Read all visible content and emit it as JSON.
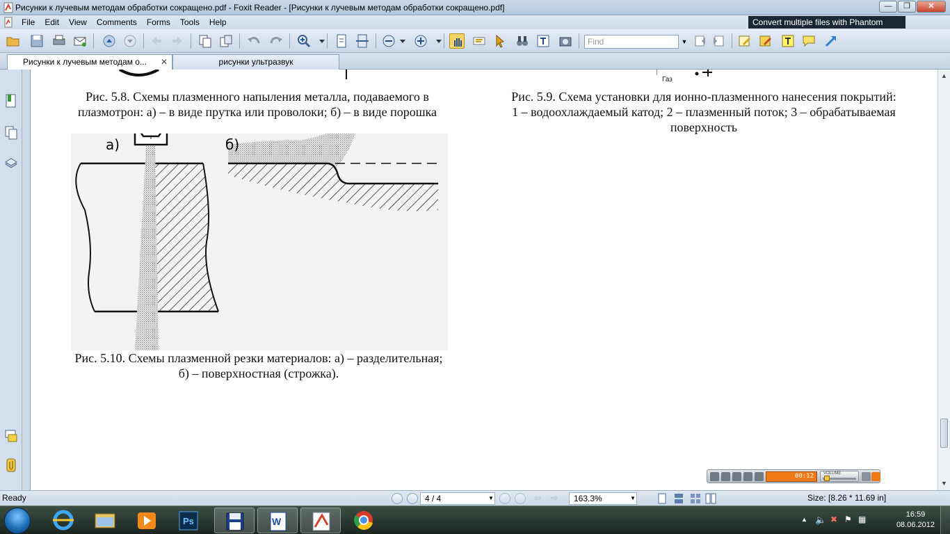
{
  "window": {
    "title": "Рисунки к лучевым методам обработки сокращено.pdf - Foxit Reader - [Рисунки к лучевым методам обработки сокращено.pdf]",
    "minimize": "—",
    "maximize": "❐",
    "close": "✕"
  },
  "menu": {
    "items": [
      "File",
      "Edit",
      "View",
      "Comments",
      "Forms",
      "Tools",
      "Help"
    ],
    "promo": "Convert multiple files with Phantom"
  },
  "toolbar": {
    "find_placeholder": "Find",
    "find_dropdown": "▼"
  },
  "tabs": [
    {
      "label": "Рисунки к лучевым методам о...",
      "close": "✕"
    },
    {
      "label": "рисунки ультразвук"
    }
  ],
  "document": {
    "top_fragment_label": "Газ",
    "caption_5_8": [
      "Рис. 5.8. Схемы плазменного напыления металла, подаваемого в",
      "плазмотрон: а) – в виде прутка или проволоки; б) – в виде порошка"
    ],
    "caption_5_9": [
      "Рис. 5.9. Схема установки для ионно-плазменного нанесения покрытий:",
      "1 – водоохлаждаемый катод; 2 – плазменный поток; 3 – обрабатываемая",
      "поверхность"
    ],
    "figure_labels": {
      "a": "а)",
      "b": "б)"
    },
    "caption_5_10": [
      "Рис. 5.10. Схемы плазменной резки материалов: а) – разделительная;",
      "б) – поверхностная (строжка)."
    ]
  },
  "player": {
    "time": "00:12",
    "volume_label": "VOLUME"
  },
  "status": {
    "ready": "Ready",
    "page": "4 / 4",
    "zoom": "163.3%",
    "size": "Size: [8.26 * 11.69 in]"
  },
  "taskbar": {
    "time": "16:59",
    "date": "08.06.2012",
    "apps": [
      "internet-explorer",
      "windows-explorer",
      "media-player",
      "photoshop",
      "save-app",
      "word",
      "foxit-reader",
      "chrome"
    ]
  }
}
